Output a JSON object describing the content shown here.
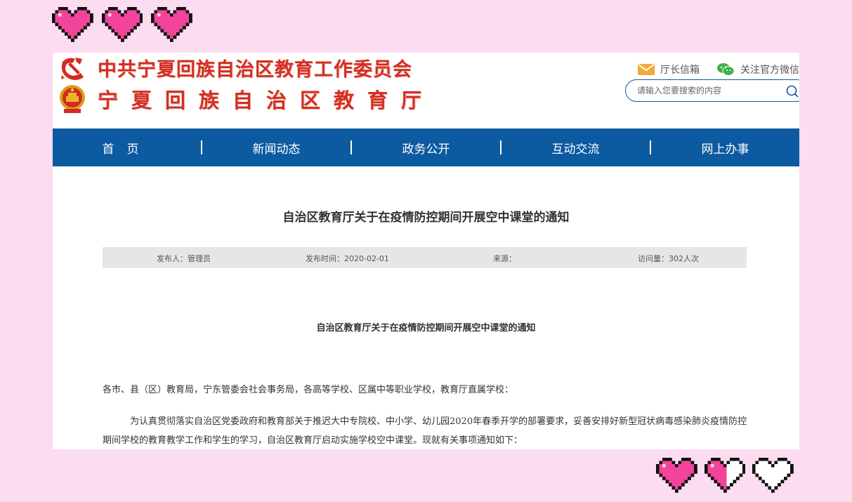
{
  "header": {
    "org_name_party": "中共宁夏回族自治区教育工作委员会",
    "org_name_dept": "宁夏回族自治区教育厅",
    "title_color": "#d22f24",
    "tools": {
      "director_mailbox": "厅长信箱",
      "follow_wechat": "关注官方微信"
    },
    "search": {
      "placeholder": "请输入您要搜索的内容"
    }
  },
  "nav": {
    "color": "#0c5aa0",
    "items": [
      {
        "label": "首页"
      },
      {
        "label": "新闻动态"
      },
      {
        "label": "政务公开"
      },
      {
        "label": "互动交流"
      },
      {
        "label": "网上办事"
      }
    ]
  },
  "article": {
    "title": "自治区教育厅关于在疫情防控期间开展空中课堂的通知",
    "meta": {
      "publisher": "发布人：管理员",
      "publish_time": "发布时间：2020-02-01",
      "source": "来源：",
      "views": "访问量：302人次"
    },
    "body_title": "自治区教育厅关于在疫情防控期间开展空中课堂的通知",
    "salutation": "各市、县（区）教育局，宁东管委会社会事务局，各高等学校、区属中等职业学校，教育厅直属学校：",
    "paragraph1": "为认真贯彻落实自治区党委政府和教育部关于推迟大中专院校、中小学、幼儿园2020年春季开学的部署要求，妥善安排好新型冠状病毒感染肺炎疫情防控期间学校的教育教学工作和学生的学习，自治区教育厅启动实施学校空中课堂。现就有关事项通知如下："
  },
  "decor": {
    "top_hearts": [
      "full",
      "full",
      "full"
    ],
    "bottom_hearts": [
      "full",
      "half",
      "empty"
    ],
    "heart_color": "#f2449a"
  }
}
